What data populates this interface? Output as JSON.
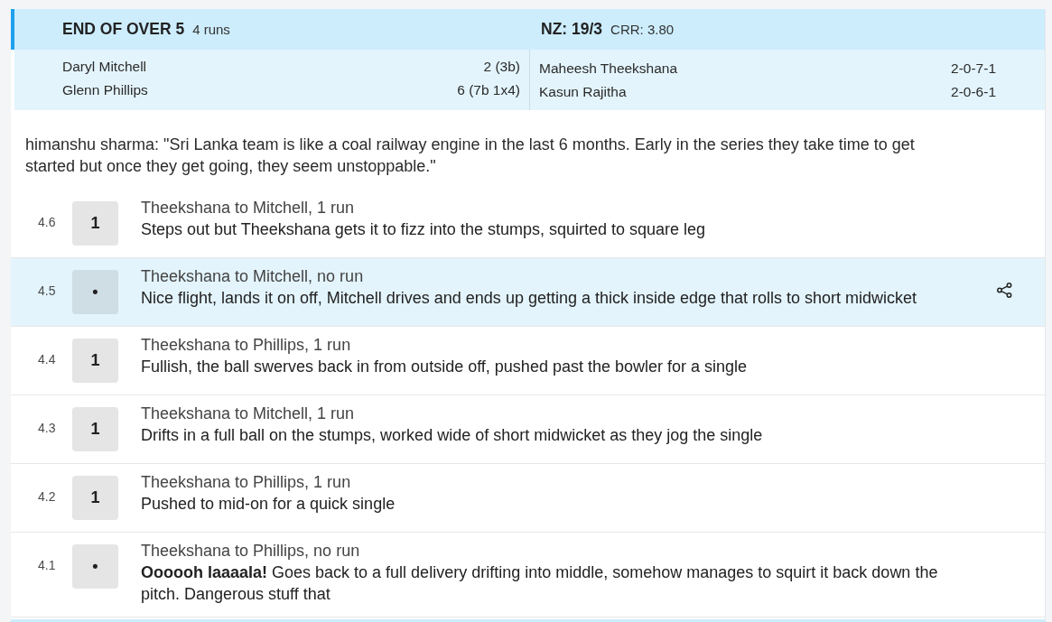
{
  "over_summary": {
    "title": "END OF OVER 5",
    "runs": "4 runs",
    "score": "NZ: 19/3",
    "crr": "CRR: 3.80",
    "batters": [
      {
        "name": "Daryl Mitchell",
        "score": "2 (3b)"
      },
      {
        "name": "Glenn Phillips",
        "score": "6 (7b 1x4)"
      }
    ],
    "bowlers": [
      {
        "name": "Maheesh Theekshana",
        "figures": "2-0-7-1"
      },
      {
        "name": "Kasun Rajitha",
        "figures": "2-0-6-1"
      }
    ]
  },
  "comment": "himanshu sharma: \"Sri Lanka team is like a coal railway engine in the last 6 months. Early in the series they take time to get started but once they get going, they seem unstoppable.\"",
  "balls": [
    {
      "over": "4.6",
      "result": "1",
      "title": "Theekshana to Mitchell, 1 run",
      "text": "Steps out but Theekshana gets it to fizz into the stumps, squirted to square leg",
      "selected": false
    },
    {
      "over": "4.5",
      "result": "•",
      "title": "Theekshana to Mitchell, no run",
      "text": "Nice flight, lands it on off, Mitchell drives and ends up getting a thick inside edge that rolls to short midwicket",
      "selected": true
    },
    {
      "over": "4.4",
      "result": "1",
      "title": "Theekshana to Phillips, 1 run",
      "text": "Fullish, the ball swerves back in from outside off, pushed past the bowler for a single",
      "selected": false
    },
    {
      "over": "4.3",
      "result": "1",
      "title": "Theekshana to Mitchell, 1 run",
      "text": "Drifts in a full ball on the stumps, worked wide of short midwicket as they jog the single",
      "selected": false
    },
    {
      "over": "4.2",
      "result": "1",
      "title": "Theekshana to Phillips, 1 run",
      "text": "Pushed to mid-on for a quick single",
      "selected": false
    },
    {
      "over": "4.1",
      "result": "•",
      "title": "Theekshana to Phillips, no run",
      "text": "**Oooooh laaaala!** Goes back to a full delivery drifting into middle, somehow manages to squirt it back down the pitch. Dangerous stuff that",
      "selected": false
    }
  ]
}
